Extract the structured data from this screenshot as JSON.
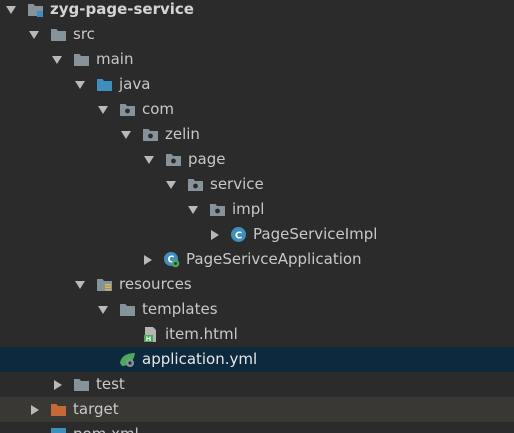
{
  "colors": {
    "background": "#2b2b2b",
    "selected_row": "#0d293e",
    "excluded_row": "#3a3834",
    "folder": "#87939a",
    "source_folder": "#3f8fbd",
    "excluded_folder": "#c46a39",
    "spring": "#4ca95b"
  },
  "tree": {
    "project": {
      "label": "zyg-page-service",
      "icon": "module-folder-icon"
    },
    "src": {
      "label": "src",
      "icon": "folder-icon"
    },
    "main": {
      "label": "main",
      "icon": "folder-icon"
    },
    "java": {
      "label": "java",
      "icon": "source-folder-icon"
    },
    "com": {
      "label": "com",
      "icon": "package-icon"
    },
    "zelin": {
      "label": "zelin",
      "icon": "package-icon"
    },
    "page": {
      "label": "page",
      "icon": "package-icon"
    },
    "service": {
      "label": "service",
      "icon": "package-icon"
    },
    "impl": {
      "label": "impl",
      "icon": "package-icon"
    },
    "page_service_impl": {
      "label": "PageServiceImpl",
      "icon": "class-icon"
    },
    "application_class": {
      "label": "PageSerivceApplication",
      "icon": "spring-boot-class-icon"
    },
    "resources": {
      "label": "resources",
      "icon": "resources-folder-icon"
    },
    "templates": {
      "label": "templates",
      "icon": "folder-icon"
    },
    "item_html": {
      "label": "item.html",
      "icon": "html-file-icon"
    },
    "application_yml": {
      "label": "application.yml",
      "icon": "spring-config-icon"
    },
    "test": {
      "label": "test",
      "icon": "folder-icon"
    },
    "target": {
      "label": "target",
      "icon": "excluded-folder-icon"
    },
    "pom_xml": {
      "label": "pom.xml",
      "icon": "maven-file-icon"
    }
  }
}
